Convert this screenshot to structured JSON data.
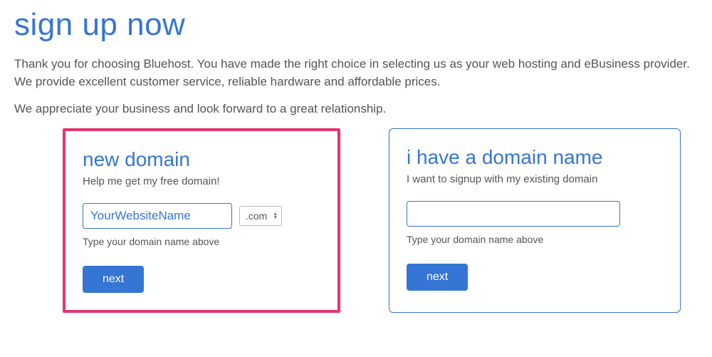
{
  "header": {
    "title": "sign up now"
  },
  "intro": {
    "para1": "Thank you for choosing Bluehost. You have made the right choice in selecting us as your web hosting and eBusiness provider. We provide excellent customer service, reliable hardware and affordable prices.",
    "para2": "We appreciate your business and look forward to a great relationship."
  },
  "newDomain": {
    "title": "new domain",
    "subtitle": "Help me get my free domain!",
    "inputValue": "YourWebsiteName",
    "tldSelected": ".com",
    "hint": "Type your domain name above",
    "button": "next"
  },
  "existingDomain": {
    "title": "i have a domain name",
    "subtitle": "I want to signup with my existing domain",
    "inputValue": "",
    "hint": "Type your domain name above",
    "button": "next"
  }
}
